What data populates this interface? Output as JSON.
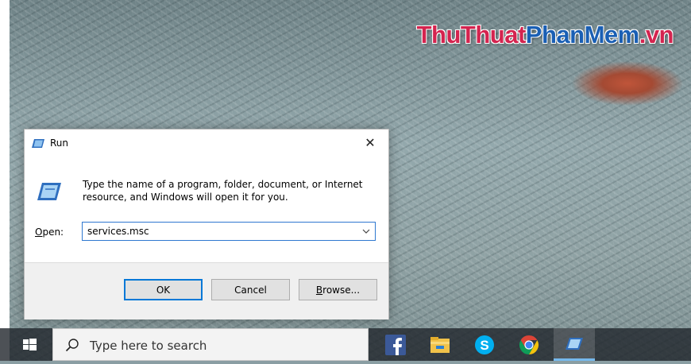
{
  "watermark": {
    "part1": "ThuThuat",
    "part2": "PhanMem",
    "part3": ".vn"
  },
  "run_dialog": {
    "title": "Run",
    "close_symbol": "✕",
    "description": "Type the name of a program, folder, document, or Internet resource, and Windows will open it for you.",
    "open_label": "Open:",
    "open_value": "services.msc",
    "buttons": {
      "ok": "OK",
      "cancel": "Cancel",
      "browse": "Browse..."
    }
  },
  "taskbar": {
    "search_placeholder": "Type here to search",
    "apps": [
      "facebook-icon",
      "file-explorer-icon",
      "skype-icon",
      "chrome-icon",
      "run-icon"
    ]
  },
  "colors": {
    "accent": "#0078d7",
    "taskbar": "#20262c"
  }
}
